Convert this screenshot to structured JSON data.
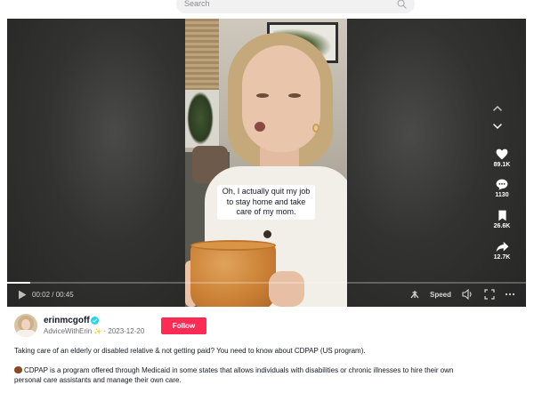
{
  "search": {
    "placeholder": "Search"
  },
  "video": {
    "caption": "Oh, I actually quit my job to stay home and take care of my mom.",
    "time_label": "00:02 / 00:45",
    "progress": 0.044,
    "speed_label": "Speed"
  },
  "actions": {
    "likes": "89.1K",
    "comments": "1130",
    "saves": "26.6K",
    "shares": "12.7K"
  },
  "author": {
    "username": "erinmcgoff",
    "nickname": "AdviceWithErin",
    "date": "2023-12-20",
    "separator": "·",
    "follow_label": "Follow"
  },
  "description": {
    "line1": "Taking care of an elderly or disabled relative & not getting paid? You need to know about CDPAP (US program).",
    "line2": "CDPAP is a program offered through Medicaid in some states that allows individuals with disabilities or chronic illnesses to hire their own",
    "line3": "personal care assistants and manage their own care."
  },
  "colors": {
    "accent": "#fe2c55",
    "verified": "#20d5ec",
    "player_bg": "#262626"
  },
  "icons": [
    "search-icon",
    "chevron-up-icon",
    "chevron-down-icon",
    "heart-icon",
    "comment-icon",
    "bookmark-icon",
    "share-icon",
    "play-icon",
    "floating-player-icon",
    "volume-icon",
    "fullscreen-icon",
    "more-icon",
    "verified-icon",
    "sparkle-icon",
    "chestnut-emoji-icon"
  ]
}
